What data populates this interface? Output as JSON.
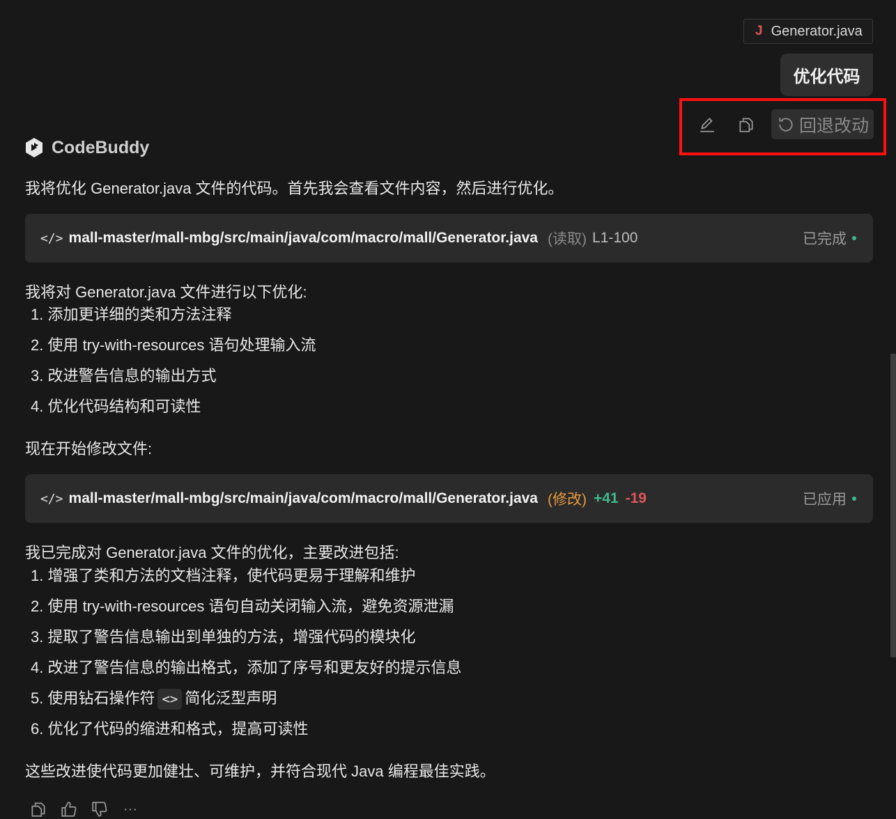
{
  "attached_file": {
    "icon": "J",
    "name": "Generator.java"
  },
  "user_message": "优化代码",
  "message_actions": {
    "edit_icon": "edit-icon",
    "copy_icon": "copy-icon",
    "revert_label": "回退改动"
  },
  "assistant": {
    "name": "CodeBuddy"
  },
  "response": {
    "intro": "我将优化 Generator.java 文件的代码。首先我会查看文件内容，然后进行优化。",
    "read_tool": {
      "path": "mall-master/mall-mbg/src/main/java/com/macro/mall/Generator.java",
      "operation": "(读取)",
      "range": "L1-100",
      "status": "已完成"
    },
    "plan_intro": "我将对 Generator.java 文件进行以下优化:",
    "plan_items": [
      "1. 添加更详细的类和方法注释",
      "2. 使用 try-with-resources 语句处理输入流",
      "3. 改进警告信息的输出方式",
      "4. 优化代码结构和可读性"
    ],
    "start_text": "现在开始修改文件:",
    "edit_tool": {
      "path": "mall-master/mall-mbg/src/main/java/com/macro/mall/Generator.java",
      "operation": "(修改)",
      "additions": "+41",
      "deletions": "-19",
      "status": "已应用"
    },
    "summary_intro": "我已完成对 Generator.java 文件的优化，主要改进包括:",
    "summary_items": [
      "1. 增强了类和方法的文档注释，使代码更易于理解和维护",
      "2. 使用 try-with-resources 语句自动关闭输入流，避免资源泄漏",
      "3. 提取了警告信息输出到单独的方法，增强代码的模块化",
      "4. 改进了警告信息的输出格式，添加了序号和更友好的提示信息"
    ],
    "summary_item5_prefix": "5. 使用钻石操作符",
    "summary_item5_code": "<>",
    "summary_item5_suffix": "简化泛型声明",
    "summary_item6": "6. 优化了代码的缩进和格式，提高可读性",
    "conclusion": "这些改进使代码更加健壮、可维护，并符合现代 Java 编程最佳实践。"
  },
  "footer_actions": {
    "more_label": "···"
  },
  "colors": {
    "background": "#181818",
    "card": "#2b2b2b",
    "success": "#3fb98c",
    "deletion": "#e0555a",
    "modify": "#e89a3c",
    "highlight": "#ff1010"
  }
}
